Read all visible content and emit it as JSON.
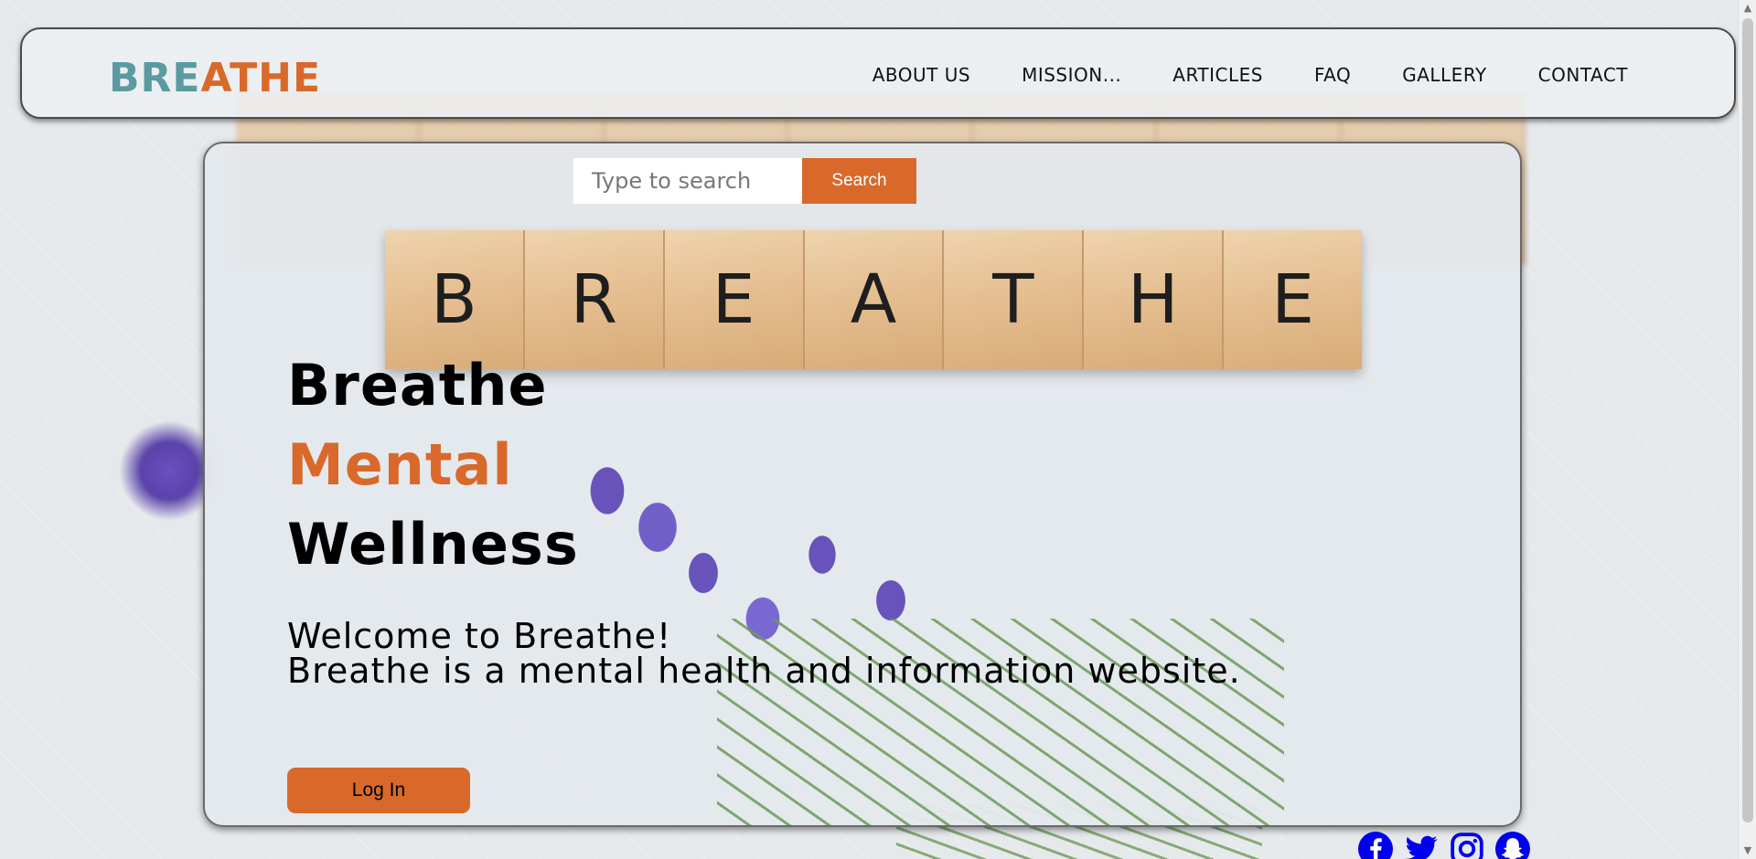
{
  "navbar": {
    "logo_part1": "BRE",
    "logo_part2": "ATHE",
    "links": [
      "ABOUT US",
      "MISSION...",
      "ARTICLES",
      "FAQ",
      "GALLERY",
      "CONTACT"
    ]
  },
  "search": {
    "placeholder": "Type to search",
    "button_label": "Search"
  },
  "tiles": [
    "B",
    "R",
    "E",
    "A",
    "T",
    "H",
    "E"
  ],
  "hero": {
    "line1": "Breathe",
    "line2": "Mental",
    "line3": "Wellness"
  },
  "welcome": {
    "line1": "Welcome to Breathe!",
    "line2": "Breathe is a mental health and information website."
  },
  "login_label": "Log In",
  "socials": [
    "facebook-icon",
    "twitter-icon",
    "instagram-icon",
    "snapchat-icon"
  ],
  "colors": {
    "accent": "#d9692a",
    "logo_teal": "#5b9aa0",
    "social_blue": "#0000ee"
  }
}
